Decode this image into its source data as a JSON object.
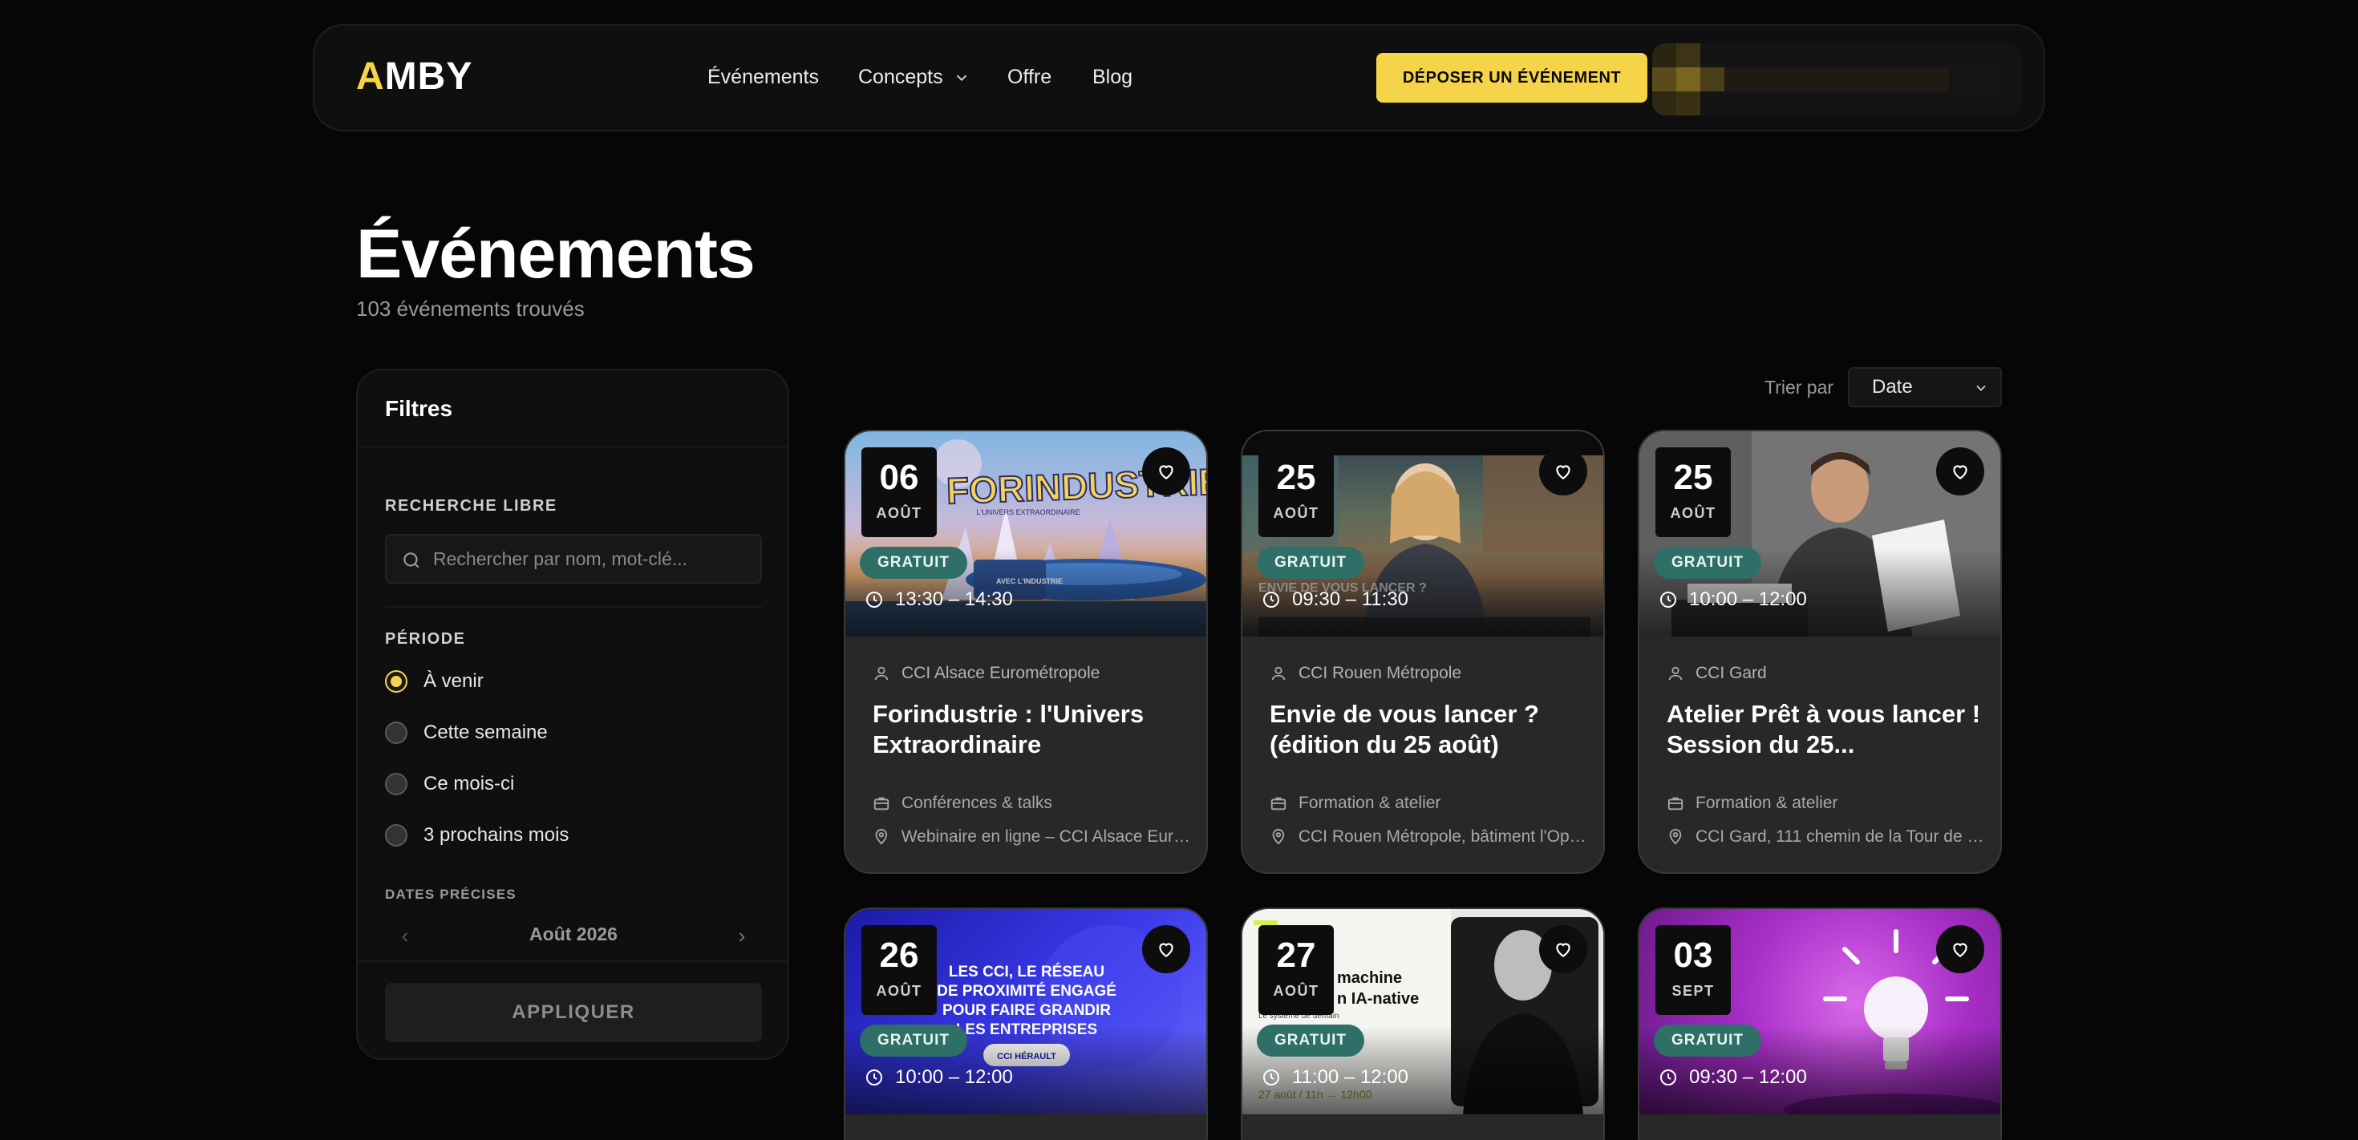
{
  "header": {
    "logo_first": "A",
    "logo_rest": "MBY",
    "nav": [
      "Événements",
      "Concepts",
      "Offre",
      "Blog"
    ],
    "cta_label": "DÉPOSER UN ÉVÉNEMENT"
  },
  "page": {
    "title": "Événements",
    "result_count": "103 événements trouvés"
  },
  "filters": {
    "title": "Filtres",
    "search_label": "RECHERCHE LIBRE",
    "search_placeholder": "Rechercher par nom, mot-clé...",
    "search_value": "",
    "period_label": "PÉRIODE",
    "period_options": [
      "À venir",
      "Cette semaine",
      "Ce mois-ci",
      "3 prochains mois"
    ],
    "period_selected": "À venir",
    "dates_label": "DATES PRÉCISES",
    "calendar_month": "Août 2026",
    "apply_label": "APPLIQUER"
  },
  "sort": {
    "label": "Trier par",
    "value": "Date"
  },
  "events": [
    {
      "day": "06",
      "month": "AOÛT",
      "price": "GRATUIT",
      "time": "13:30 – 14:30",
      "organizer": "CCI Alsace Eurométropole",
      "title": "Forindustrie : l'Univers Extraordinaire",
      "category": "Conférences & talks",
      "location": "Webinaire en ligne – CCI Alsace Euro..."
    },
    {
      "day": "25",
      "month": "AOÛT",
      "price": "GRATUIT",
      "time": "09:30 – 11:30",
      "organizer": "CCI Rouen Métropole",
      "title": "Envie de vous lancer ? (édition du 25 août)",
      "category": "Formation & atelier",
      "location": "CCI Rouen Métropole, bâtiment l'Ope..."
    },
    {
      "day": "25",
      "month": "AOÛT",
      "price": "GRATUIT",
      "time": "10:00 – 12:00",
      "organizer": "CCI Gard",
      "title": "Atelier Prêt à vous lancer ! Session du 25...",
      "category": "Formation & atelier",
      "location": "CCI Gard, 111 chemin de la Tour de l'..."
    },
    {
      "day": "26",
      "month": "AOÛT",
      "price": "GRATUIT",
      "time": "10:00 – 12:00"
    },
    {
      "day": "27",
      "month": "AOÛT",
      "price": "GRATUIT",
      "time": "11:00 – 12:00"
    },
    {
      "day": "03",
      "month": "SEPT",
      "price": "GRATUIT",
      "time": "09:30 – 12:00"
    }
  ],
  "event_images": {
    "forindustrie_headline": "FORINDUSTRIE",
    "forindustrie_sub": "L'UNIVERS EXTRAORDINAIRE",
    "forindustrie_tag": "AVEC L'INDUSTRIE",
    "rouen_caption": "ENVIE DE VOUS LANCER ?",
    "cci_headline": [
      "LES CCI, LE RÉSEAU",
      "DE PROXIMITÉ ENGAGÉ",
      "POUR FAIRE GRANDIR",
      "LES ENTREPRISES"
    ],
    "cci_logo": "CCI HÉRAULT",
    "ia_headline": [
      "machine",
      "n IA-native"
    ],
    "ia_sub": "Le système de demain",
    "ia_date": "27 août / 11h → 12h00"
  },
  "colors": {
    "accent": "#f6d449",
    "price_badge": "#2e6f68",
    "card_bg": "#282828",
    "page_bg": "#060606"
  },
  "icons": [
    "chevron-down-icon",
    "search-icon",
    "heart-icon",
    "clock-icon",
    "user-icon",
    "briefcase-icon",
    "map-pin-icon",
    "chevron-left-icon",
    "chevron-right-icon"
  ]
}
